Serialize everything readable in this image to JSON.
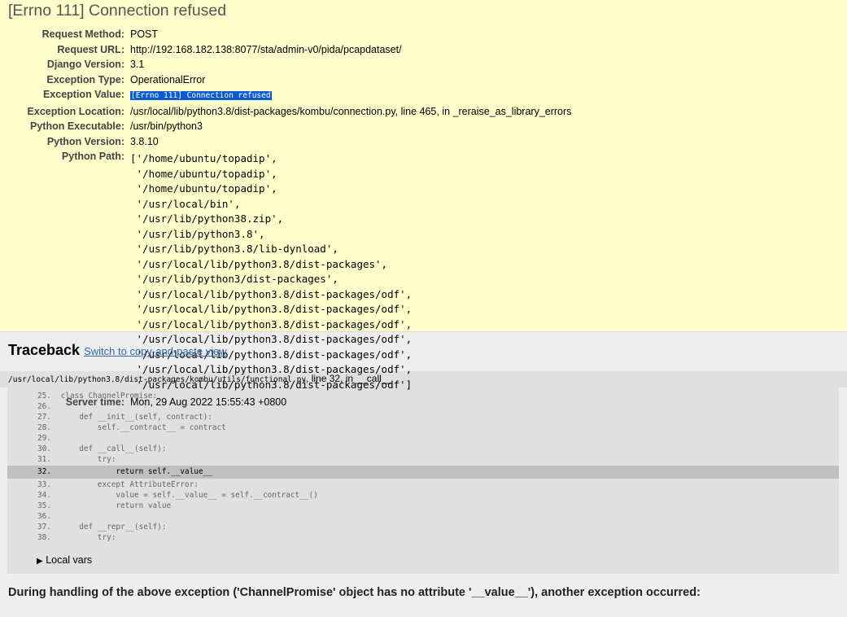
{
  "summary": {
    "title": "[Errno 111] Connection refused",
    "rows": [
      {
        "label": "Request Method:",
        "value": "POST"
      },
      {
        "label": "Request URL:",
        "value": "http://192.168.182.138:8077/sta/admin-v0/pida/pcapdataset/"
      },
      {
        "label": "Django Version:",
        "value": "3.1"
      },
      {
        "label": "Exception Type:",
        "value": "OperationalError"
      },
      {
        "label": "Exception Value:",
        "value": "[Errno 111] Connection refused"
      },
      {
        "label": "Exception Location:",
        "value": "/usr/local/lib/python3.8/dist-packages/kombu/connection.py, line 465, in _reraise_as_library_errors"
      },
      {
        "label": "Python Executable:",
        "value": "/usr/bin/python3"
      },
      {
        "label": "Python Version:",
        "value": "3.8.10"
      }
    ],
    "python_path_label": "Python Path:",
    "python_path": [
      "['/home/ubuntu/topadip',",
      " '/home/ubuntu/topadip',",
      " '/home/ubuntu/topadip',",
      " '/usr/local/bin',",
      " '/usr/lib/python38.zip',",
      " '/usr/lib/python3.8',",
      " '/usr/lib/python3.8/lib-dynload',",
      " '/usr/local/lib/python3.8/dist-packages',",
      " '/usr/lib/python3/dist-packages',",
      " '/usr/local/lib/python3.8/dist-packages/odf',",
      " '/usr/local/lib/python3.8/dist-packages/odf',",
      " '/usr/local/lib/python3.8/dist-packages/odf',",
      " '/usr/local/lib/python3.8/dist-packages/odf',",
      " '/usr/local/lib/python3.8/dist-packages/odf',",
      " '/usr/local/lib/python3.8/dist-packages/odf',",
      " '/usr/local/lib/python3.8/dist-packages/odf']"
    ],
    "server_time_label": "Server time:",
    "server_time": "Mon, 29 Aug 2022 15:55:43 +0800"
  },
  "traceback": {
    "heading": "Traceback",
    "switch_link": "Switch to copy-and-paste view",
    "frame": {
      "file": "/usr/local/lib/python3.8/dist-packages/kombu/utils/functional.py",
      "location": ", line 32, in __call__",
      "lines": [
        {
          "no": "25.",
          "code": "class ChannelPromise:"
        },
        {
          "no": "26.",
          "code": ""
        },
        {
          "no": "27.",
          "code": "    def __init__(self, contract):"
        },
        {
          "no": "28.",
          "code": "        self.__contract__ = contract"
        },
        {
          "no": "29.",
          "code": ""
        },
        {
          "no": "30.",
          "code": "    def __call__(self):"
        },
        {
          "no": "31.",
          "code": "        try:"
        },
        {
          "no": "32.",
          "code": "            return self.__value__"
        },
        {
          "no": "33.",
          "code": "        except AttributeError:"
        },
        {
          "no": "34.",
          "code": "            value = self.__value__ = self.__contract__()"
        },
        {
          "no": "35.",
          "code": "            return value"
        },
        {
          "no": "36.",
          "code": ""
        },
        {
          "no": "37.",
          "code": "    def __repr__(self):"
        },
        {
          "no": "38.",
          "code": "        try:"
        }
      ],
      "current_line": "32.",
      "local_vars_label": "Local vars"
    },
    "during_message": "During handling of the above exception ('ChannelPromise' object has no attribute '__value__'), another exception occurred:"
  }
}
